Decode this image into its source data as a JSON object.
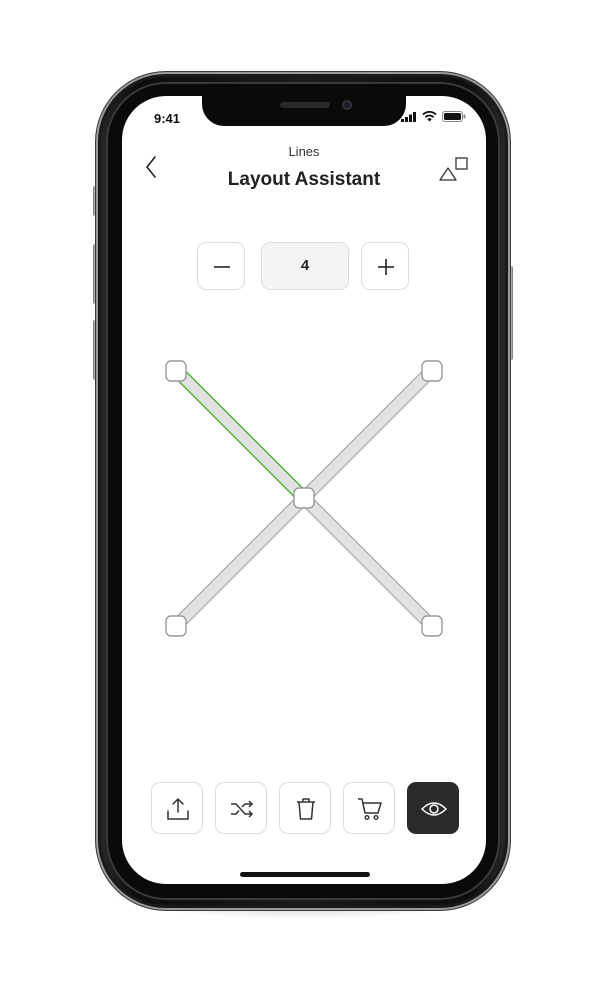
{
  "status_bar": {
    "time": "9:41"
  },
  "header": {
    "subtitle": "Lines",
    "title": "Layout Assistant"
  },
  "stepper": {
    "value": "4"
  },
  "canvas": {
    "selected_color": "#4caf32",
    "line_fill": "#e2e2e2",
    "line_stroke": "#a8a8a8"
  },
  "toolbar": {
    "items": [
      {
        "icon": "share-icon"
      },
      {
        "icon": "shuffle-icon"
      },
      {
        "icon": "trash-icon"
      },
      {
        "icon": "cart-icon"
      },
      {
        "icon": "eye-icon",
        "active": true
      }
    ]
  }
}
